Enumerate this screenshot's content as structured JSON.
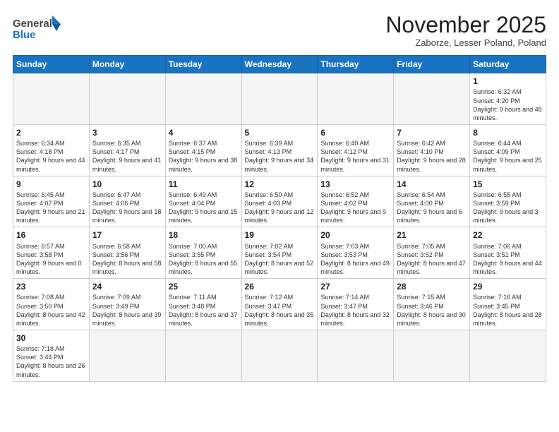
{
  "logo": {
    "line1": "General",
    "line2": "Blue"
  },
  "title": "November 2025",
  "subtitle": "Zaborze, Lesser Poland, Poland",
  "days_of_week": [
    "Sunday",
    "Monday",
    "Tuesday",
    "Wednesday",
    "Thursday",
    "Friday",
    "Saturday"
  ],
  "weeks": [
    [
      {
        "day": "",
        "info": ""
      },
      {
        "day": "",
        "info": ""
      },
      {
        "day": "",
        "info": ""
      },
      {
        "day": "",
        "info": ""
      },
      {
        "day": "",
        "info": ""
      },
      {
        "day": "",
        "info": ""
      },
      {
        "day": "1",
        "info": "Sunrise: 6:32 AM\nSunset: 4:20 PM\nDaylight: 9 hours and 48 minutes."
      }
    ],
    [
      {
        "day": "2",
        "info": "Sunrise: 6:34 AM\nSunset: 4:18 PM\nDaylight: 9 hours and 44 minutes."
      },
      {
        "day": "3",
        "info": "Sunrise: 6:35 AM\nSunset: 4:17 PM\nDaylight: 9 hours and 41 minutes."
      },
      {
        "day": "4",
        "info": "Sunrise: 6:37 AM\nSunset: 4:15 PM\nDaylight: 9 hours and 38 minutes."
      },
      {
        "day": "5",
        "info": "Sunrise: 6:39 AM\nSunset: 4:13 PM\nDaylight: 9 hours and 34 minutes."
      },
      {
        "day": "6",
        "info": "Sunrise: 6:40 AM\nSunset: 4:12 PM\nDaylight: 9 hours and 31 minutes."
      },
      {
        "day": "7",
        "info": "Sunrise: 6:42 AM\nSunset: 4:10 PM\nDaylight: 9 hours and 28 minutes."
      },
      {
        "day": "8",
        "info": "Sunrise: 6:44 AM\nSunset: 4:09 PM\nDaylight: 9 hours and 25 minutes."
      }
    ],
    [
      {
        "day": "9",
        "info": "Sunrise: 6:45 AM\nSunset: 4:07 PM\nDaylight: 9 hours and 21 minutes."
      },
      {
        "day": "10",
        "info": "Sunrise: 6:47 AM\nSunset: 4:06 PM\nDaylight: 9 hours and 18 minutes."
      },
      {
        "day": "11",
        "info": "Sunrise: 6:49 AM\nSunset: 4:04 PM\nDaylight: 9 hours and 15 minutes."
      },
      {
        "day": "12",
        "info": "Sunrise: 6:50 AM\nSunset: 4:03 PM\nDaylight: 9 hours and 12 minutes."
      },
      {
        "day": "13",
        "info": "Sunrise: 6:52 AM\nSunset: 4:02 PM\nDaylight: 9 hours and 9 minutes."
      },
      {
        "day": "14",
        "info": "Sunrise: 6:54 AM\nSunset: 4:00 PM\nDaylight: 9 hours and 6 minutes."
      },
      {
        "day": "15",
        "info": "Sunrise: 6:55 AM\nSunset: 3:59 PM\nDaylight: 9 hours and 3 minutes."
      }
    ],
    [
      {
        "day": "16",
        "info": "Sunrise: 6:57 AM\nSunset: 3:58 PM\nDaylight: 9 hours and 0 minutes."
      },
      {
        "day": "17",
        "info": "Sunrise: 6:58 AM\nSunset: 3:56 PM\nDaylight: 8 hours and 58 minutes."
      },
      {
        "day": "18",
        "info": "Sunrise: 7:00 AM\nSunset: 3:55 PM\nDaylight: 8 hours and 55 minutes."
      },
      {
        "day": "19",
        "info": "Sunrise: 7:02 AM\nSunset: 3:54 PM\nDaylight: 8 hours and 52 minutes."
      },
      {
        "day": "20",
        "info": "Sunrise: 7:03 AM\nSunset: 3:53 PM\nDaylight: 8 hours and 49 minutes."
      },
      {
        "day": "21",
        "info": "Sunrise: 7:05 AM\nSunset: 3:52 PM\nDaylight: 8 hours and 47 minutes."
      },
      {
        "day": "22",
        "info": "Sunrise: 7:06 AM\nSunset: 3:51 PM\nDaylight: 8 hours and 44 minutes."
      }
    ],
    [
      {
        "day": "23",
        "info": "Sunrise: 7:08 AM\nSunset: 3:50 PM\nDaylight: 8 hours and 42 minutes."
      },
      {
        "day": "24",
        "info": "Sunrise: 7:09 AM\nSunset: 3:49 PM\nDaylight: 8 hours and 39 minutes."
      },
      {
        "day": "25",
        "info": "Sunrise: 7:11 AM\nSunset: 3:48 PM\nDaylight: 8 hours and 37 minutes."
      },
      {
        "day": "26",
        "info": "Sunrise: 7:12 AM\nSunset: 3:47 PM\nDaylight: 8 hours and 35 minutes."
      },
      {
        "day": "27",
        "info": "Sunrise: 7:14 AM\nSunset: 3:47 PM\nDaylight: 8 hours and 32 minutes."
      },
      {
        "day": "28",
        "info": "Sunrise: 7:15 AM\nSunset: 3:46 PM\nDaylight: 8 hours and 30 minutes."
      },
      {
        "day": "29",
        "info": "Sunrise: 7:16 AM\nSunset: 3:45 PM\nDaylight: 8 hours and 28 minutes."
      }
    ],
    [
      {
        "day": "30",
        "info": "Sunrise: 7:18 AM\nSunset: 3:44 PM\nDaylight: 8 hours and 26 minutes."
      },
      {
        "day": "",
        "info": ""
      },
      {
        "day": "",
        "info": ""
      },
      {
        "day": "",
        "info": ""
      },
      {
        "day": "",
        "info": ""
      },
      {
        "day": "",
        "info": ""
      },
      {
        "day": "",
        "info": ""
      }
    ]
  ]
}
